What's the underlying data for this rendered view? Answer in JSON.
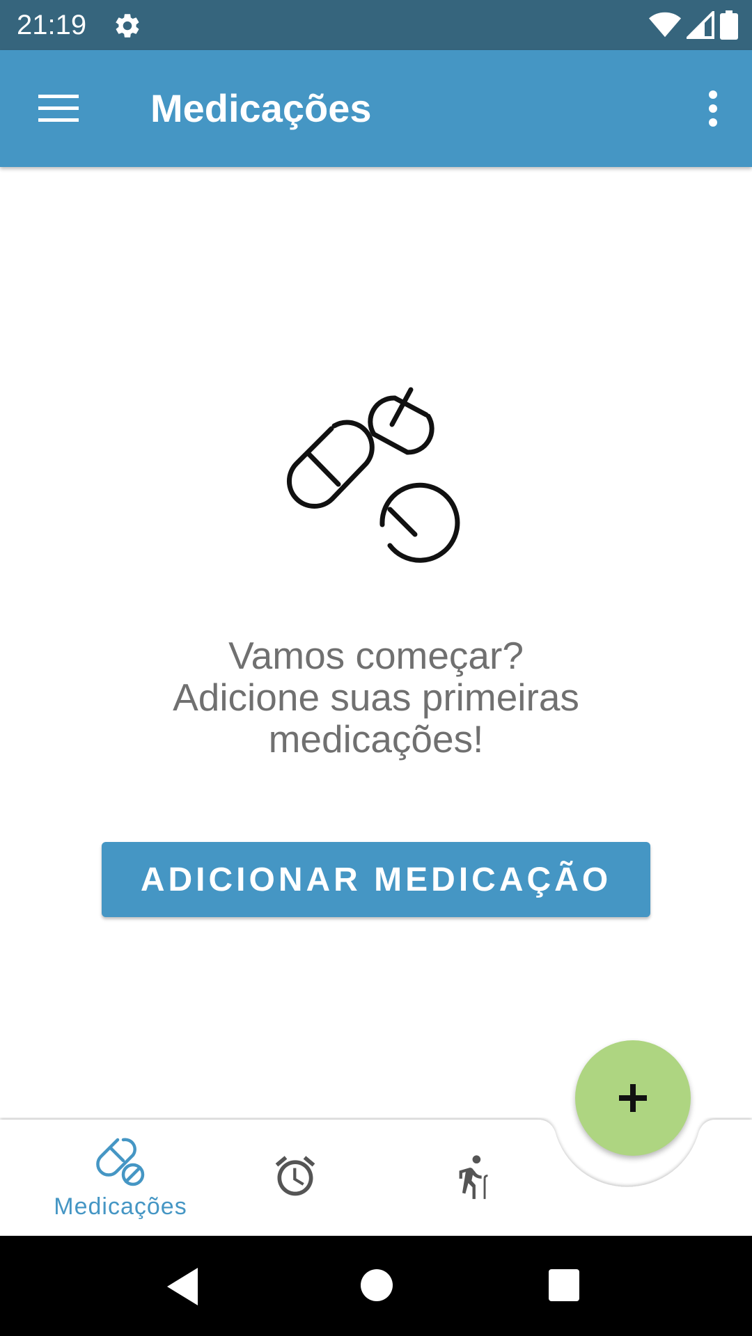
{
  "status_bar": {
    "time": "21:19",
    "icons": [
      "settings-gear-icon",
      "wifi-icon",
      "cell-signal-icon",
      "battery-icon"
    ]
  },
  "app_bar": {
    "title": "Medicações",
    "menu_icon": "hamburger-menu-icon",
    "overflow_icon": "more-vert-icon",
    "background_color": "#4596c4"
  },
  "empty_state": {
    "illustration_icon": "pills-icon",
    "message_lines": [
      "Vamos começar?",
      "Adicione suas primeiras",
      "medicações!"
    ],
    "button_label": "ADICIONAR MEDICAÇÃO"
  },
  "fab": {
    "icon": "plus-icon",
    "color": "#aed581"
  },
  "bottom_nav": {
    "items": [
      {
        "label": "Medicações",
        "icon": "pill-icon",
        "active": true
      },
      {
        "icon": "alarm-icon",
        "active": false
      },
      {
        "icon": "elderly-walking-icon",
        "active": false
      }
    ],
    "active_color": "#4596c4",
    "inactive_color": "#555555"
  },
  "system_nav": {
    "icons": [
      "back-icon",
      "home-icon",
      "recents-icon"
    ]
  }
}
